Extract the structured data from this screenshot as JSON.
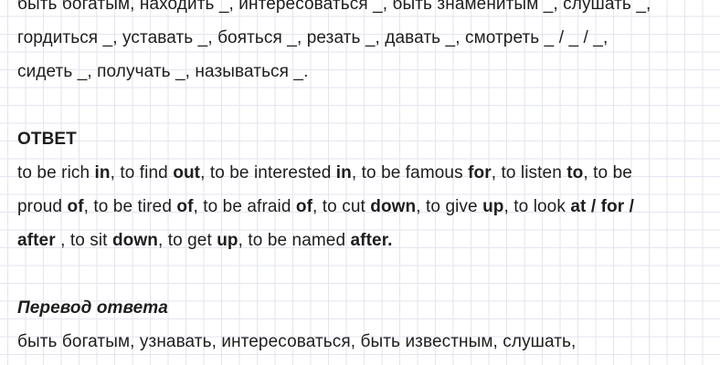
{
  "exercise": {
    "lines": [
      "быть богатым, находить _, интересоваться _, быть знаменитым _, слушать _,",
      "гордиться _, уставать _, бояться _, резать _, давать _, смотреть _ / _ / _,",
      "сидеть _, получать _, называться _."
    ]
  },
  "answer": {
    "heading": "ОТВЕТ",
    "line1": {
      "t1": "to be rich ",
      "b1": "in",
      "t2": ", to find ",
      "b2": "out",
      "t3": ", to be interested ",
      "b3": "in",
      "t4": ", to be famous ",
      "b4": "for",
      "t5": ", to listen ",
      "b5": "to",
      "t6": ", to be"
    },
    "line2": {
      "t1": "proud ",
      "b1": "of",
      "t2": ", to be tired ",
      "b2": "of",
      "t3": ", to be afraid ",
      "b3": "of",
      "t4": ", to cut ",
      "b4": "down",
      "t5": ", to give ",
      "b5": "up",
      "t6": ", to look ",
      "b6": "at / for /"
    },
    "line3": {
      "b1": "after",
      "t1": " , to sit ",
      "b2": "down",
      "t2": ", to get ",
      "b3": "up",
      "t3": ", to be named ",
      "b4": "after."
    }
  },
  "translation": {
    "heading": "Перевод ответа",
    "lines": [
      "быть богатым, узнавать, интересоваться, быть известным, слушать,"
    ]
  }
}
